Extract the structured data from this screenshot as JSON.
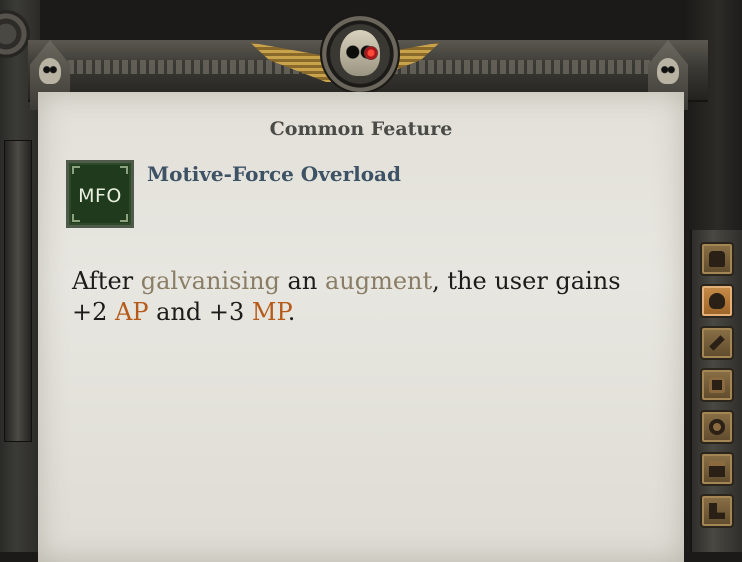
{
  "panel": {
    "title": "Common Feature",
    "feature": {
      "abbreviation": "MFO",
      "name": "Motive-Force Overload"
    },
    "description": {
      "part1": "After ",
      "keyword1": "galvanising",
      "part2": " an ",
      "keyword2": "augment",
      "part3": ", the user gains +2 ",
      "stat1": "AP",
      "part4": " and +3 ",
      "stat2": "MP",
      "part5": "."
    }
  },
  "colors": {
    "keyword": "#8a7d66",
    "stat": "#b65a1a",
    "feature_name": "#3e5266",
    "icon_bg": "#1f3a1c"
  },
  "side_tabs": [
    {
      "icon": "chest-icon",
      "active": false
    },
    {
      "icon": "skull-helmet-icon",
      "active": true
    },
    {
      "icon": "tools-icon",
      "active": false
    },
    {
      "icon": "armor-plate-icon",
      "active": false
    },
    {
      "icon": "gear-icon",
      "active": false
    },
    {
      "icon": "cabinet-icon",
      "active": false
    },
    {
      "icon": "boot-icon",
      "active": false
    }
  ]
}
